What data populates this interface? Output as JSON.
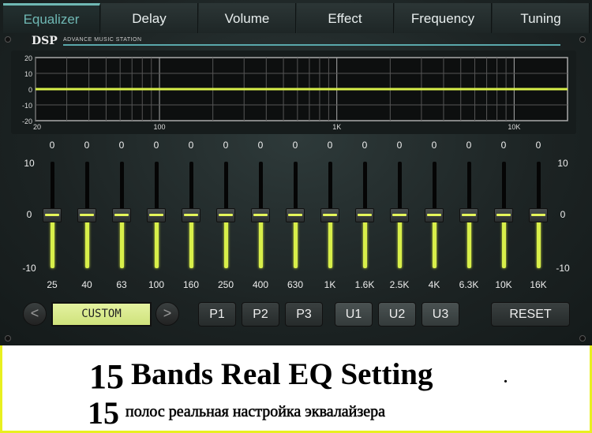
{
  "tabs": [
    {
      "label": "Equalizer",
      "active": true
    },
    {
      "label": "Delay"
    },
    {
      "label": "Volume"
    },
    {
      "label": "Effect"
    },
    {
      "label": "Frequency"
    },
    {
      "label": "Tuning"
    }
  ],
  "brand": {
    "logo": "DSP",
    "subtitle": "ADVANCE MUSIC STATION"
  },
  "graph": {
    "y_ticks": [
      "20",
      "10",
      "0",
      "-10",
      "-20"
    ],
    "x_ticks": [
      "20",
      "100",
      "1K",
      "10K"
    ],
    "curve_color": "#d8ef4a",
    "x_range_hz": [
      20,
      20000
    ],
    "y_range_db": [
      -20,
      20
    ],
    "scale": "log"
  },
  "eq": {
    "scale_top": "10",
    "scale_mid": "0",
    "scale_bottom": "-10",
    "range": [
      -10,
      10
    ],
    "bands": [
      {
        "freq": "25",
        "value": "0"
      },
      {
        "freq": "40",
        "value": "0"
      },
      {
        "freq": "63",
        "value": "0"
      },
      {
        "freq": "100",
        "value": "0"
      },
      {
        "freq": "160",
        "value": "0"
      },
      {
        "freq": "250",
        "value": "0"
      },
      {
        "freq": "400",
        "value": "0"
      },
      {
        "freq": "630",
        "value": "0"
      },
      {
        "freq": "1K",
        "value": "0"
      },
      {
        "freq": "1.6K",
        "value": "0"
      },
      {
        "freq": "2.5K",
        "value": "0"
      },
      {
        "freq": "4K",
        "value": "0"
      },
      {
        "freq": "6.3K",
        "value": "0"
      },
      {
        "freq": "10K",
        "value": "0"
      },
      {
        "freq": "16K",
        "value": "0"
      }
    ]
  },
  "presets": {
    "prev": "<",
    "next": ">",
    "current": "CUSTOM",
    "buttons": [
      "P1",
      "P2",
      "P3",
      "U1",
      "U2",
      "U3"
    ],
    "reset": "RESET"
  },
  "banner": {
    "num1": "15",
    "line1": "Bands Real EQ Setting",
    "dot": ".",
    "num2": "15",
    "line2": "полос реальная настройка эквалайзера"
  }
}
